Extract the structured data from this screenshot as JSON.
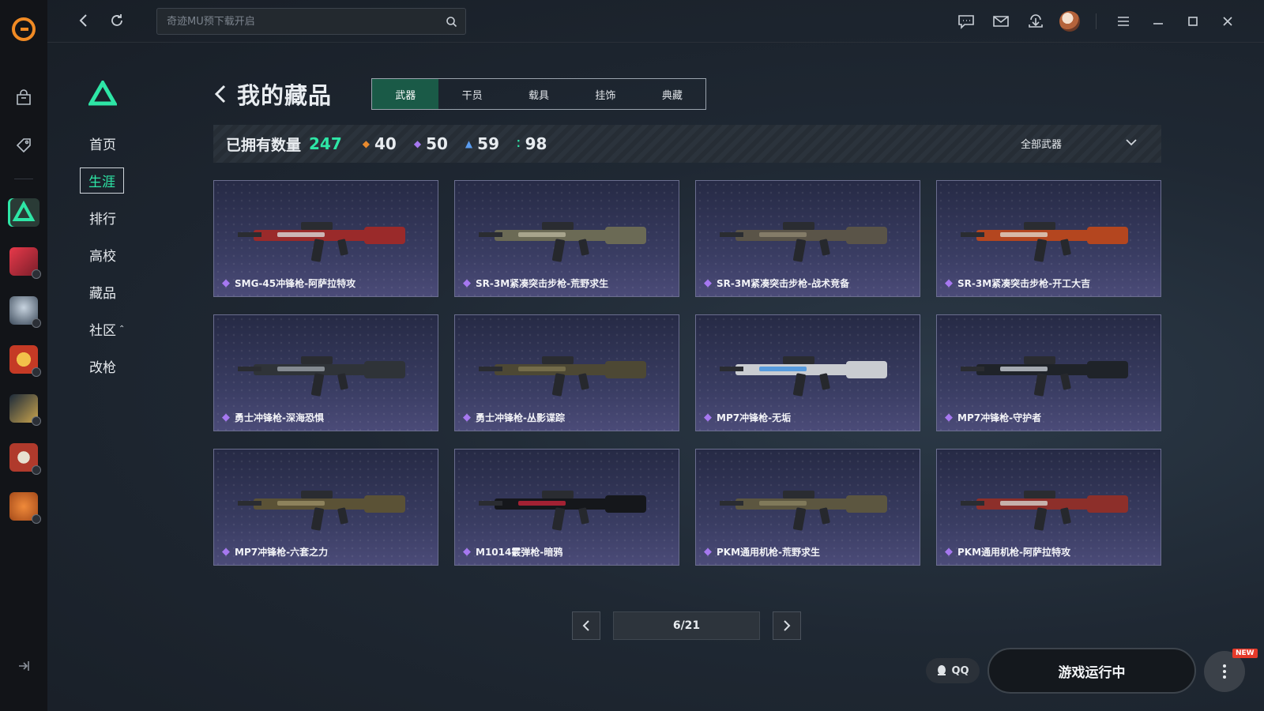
{
  "app": {
    "search": {
      "placeholder": "奇迹MU预下载开启"
    }
  },
  "sub_nav": {
    "items": [
      {
        "label": "首页"
      },
      {
        "label": "生涯",
        "active": true
      },
      {
        "label": "排行"
      },
      {
        "label": "高校"
      },
      {
        "label": "藏品"
      },
      {
        "label": "社区",
        "caret": "⌃"
      },
      {
        "label": "改枪"
      }
    ]
  },
  "page": {
    "title": "我的藏品",
    "tabs": [
      "武器",
      "干员",
      "载具",
      "挂饰",
      "典藏"
    ],
    "active_tab": "武器"
  },
  "stats": {
    "owned_label": "已拥有数量",
    "owned_count": "247",
    "tiers": [
      {
        "icon": "orange-diamond-icon",
        "color": "#e88a2e",
        "glyph": "◆",
        "value": "40"
      },
      {
        "icon": "purple-diamond-icon",
        "color": "#a678f0",
        "glyph": "◆",
        "value": "50"
      },
      {
        "icon": "blue-chevron-icon",
        "color": "#5a9cf0",
        "glyph": "▲",
        "value": "59"
      },
      {
        "icon": "green-dots-icon",
        "color": "#2ee6a6",
        "glyph": "⁚",
        "value": "98"
      }
    ],
    "filter_label": "全部武器"
  },
  "items": [
    {
      "name": "SMG-45冲锋枪-阿萨拉特攻",
      "weapon_color": "#9a2a2a",
      "accent": "#d8d8d8"
    },
    {
      "name": "SR-3M紧凑突击步枪-荒野求生",
      "weapon_color": "#6b6a55",
      "accent": "#b7b39a"
    },
    {
      "name": "SR-3M紧凑突击步枪-战术竞备",
      "weapon_color": "#5a5448",
      "accent": "#8e8670"
    },
    {
      "name": "SR-3M紧凑突击步枪-开工大吉",
      "weapon_color": "#b4461f",
      "accent": "#e0d6c8"
    },
    {
      "name": "勇士冲锋枪-深海恐惧",
      "weapon_color": "#2f3338",
      "accent": "#9aa0a8"
    },
    {
      "name": "勇士冲锋枪-丛影谍踪",
      "weapon_color": "#4d4834",
      "accent": "#7e7650"
    },
    {
      "name": "MP7冲锋枪-无垢",
      "weapon_color": "#c9ccd1",
      "accent": "#3b8fe0"
    },
    {
      "name": "MP7冲锋枪-守护者",
      "weapon_color": "#1f2329",
      "accent": "#c7ccd3"
    },
    {
      "name": "MP7冲锋枪-六套之力",
      "weapon_color": "#5b5236",
      "accent": "#9a8e66"
    },
    {
      "name": "M1014霰弹枪-暗鸦",
      "weapon_color": "#15171b",
      "accent": "#c7243a"
    },
    {
      "name": "PKM通用机枪-荒野求生",
      "weapon_color": "#5c5640",
      "accent": "#8a8260"
    },
    {
      "name": "PKM通用机枪-阿萨拉特攻",
      "weapon_color": "#8d2f2a",
      "accent": "#d5d2cc"
    }
  ],
  "pagination": {
    "page_text": "6/21"
  },
  "footer": {
    "qq_label": "QQ",
    "run_label": "游戏运行中",
    "new_badge": "NEW"
  },
  "colors": {
    "accent": "#2ee6a6",
    "gem": "#a678f0"
  }
}
